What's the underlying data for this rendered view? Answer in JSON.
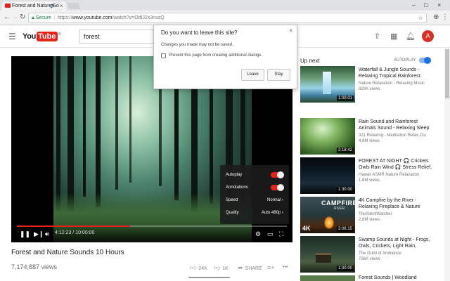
{
  "browser": {
    "tab_title": "Forest and Nature So",
    "tab_audio_icon": "speaker-icon",
    "tab_close": "×",
    "window_controls": [
      "–",
      "□",
      "×"
    ],
    "secure_label": "Secure",
    "url_scheme": "https://",
    "url_host": "www.youtube.com",
    "url_path": "/watch?v=OdIJ2x3nxzQ"
  },
  "header": {
    "logo_you": "You",
    "logo_tube": "Tube",
    "logo_region": "IE",
    "search_value": "forest",
    "avatar_letter": "A"
  },
  "player": {
    "progress": 0.42,
    "time": "4:12:23 / 10:00:00",
    "settings": [
      {
        "label": "Autoplay",
        "type": "toggle",
        "on": true
      },
      {
        "label": "Annotations",
        "type": "toggle",
        "on": true
      },
      {
        "label": "Speed",
        "type": "value",
        "value": "Normal"
      },
      {
        "label": "Quality",
        "type": "value",
        "value": "Auto 480p"
      }
    ]
  },
  "video": {
    "title": "Forest and Nature Sounds 10 Hours",
    "views": "7,174,887 views",
    "likes": "24K",
    "dislikes": "1K",
    "share": "SHARE",
    "more": "•••",
    "like_ratio": 0.96
  },
  "sidebar": {
    "heading": "Up next",
    "autoplay_label": "AUTOPLAY",
    "items": [
      {
        "title": "Waterfall & Jungle Sounds - Relaxing Tropical Rainforest",
        "channel": "Nature Relaxation - Relaxing Music",
        "views": "820K views",
        "duration": "1:00:01"
      },
      {
        "title": "Rain Sound and Rainforest Animals Sound - Relaxing Sleep",
        "channel": "321 Relaxing - Meditation Relax Clu",
        "views": "4.6M views",
        "duration": "2:18:42"
      },
      {
        "title": "FOREST AT NIGHT 🎧 Crickets Owls Rain Wind 🎧 Stress Relief,",
        "channel": "Hawaii ASMR Nature Relaxation",
        "views": "1.8M views",
        "duration": "1:30:00"
      },
      {
        "title": "4K Campfire by the River - Relaxing Fireplace & Nature",
        "channel": "TheSilentWatcher",
        "views": "2.8M views",
        "duration": "3:06:15",
        "thumb_text": "CAMPFIRE",
        "thumb_sub": "RIVER",
        "badge": "4K"
      },
      {
        "title": "Swamp Sounds at Night - Frogs, Owls, Crickets, Light Rain,",
        "channel": "The Guild of Ambience",
        "views": "736K views",
        "duration": "1:00:00"
      },
      {
        "title": "Forest Sounds | Woodland",
        "channel": "",
        "views": "",
        "duration": ""
      }
    ]
  },
  "dialog": {
    "title": "Do you want to leave this site?",
    "message": "Changes you made may not be saved.",
    "checkbox_label": "Prevent this page from creating additional dialogs.",
    "leave_label": "Leave",
    "stay_label": "Stay",
    "close": "×"
  },
  "colors": {
    "youtube_red": "#e62117",
    "secure_green": "#0b8043",
    "autoplay_blue": "#1a73e8"
  }
}
